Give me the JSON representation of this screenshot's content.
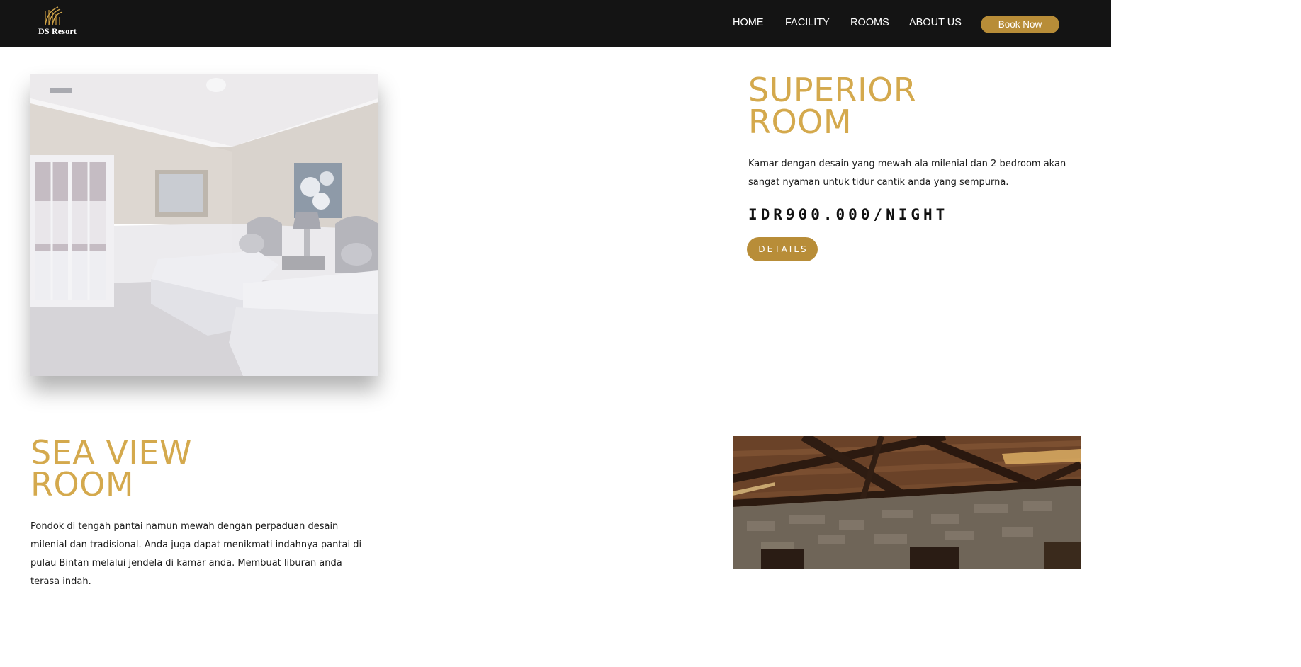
{
  "brand": {
    "logo_text": "DS Resort"
  },
  "nav": {
    "items": [
      {
        "label": "HOME"
      },
      {
        "label": "FACILITY"
      },
      {
        "label": "ROOMS"
      },
      {
        "label": "ABOUT US"
      }
    ],
    "cta_label": "Book Now"
  },
  "colors": {
    "accent": "#b88d38",
    "title_gold": "#d4a94d",
    "navbar_bg": "#141414"
  },
  "rooms": [
    {
      "title_line1": "SUPERIOR",
      "title_line2": "ROOM",
      "description": "Kamar dengan desain yang mewah ala milenial dan 2 bedroom akan sangat nyaman untuk tidur cantik anda yang sempurna.",
      "price": "IDR900.000/NIGHT",
      "details_label": "DETAILS"
    },
    {
      "title_line1": "SEA VIEW",
      "title_line2": "ROOM",
      "description": "Pondok di tengah pantai namun mewah dengan perpaduan desain milenial dan tradisional. Anda juga dapat menikmati indahnya pantai di pulau Bintan melalui jendela di kamar anda. Membuat liburan anda terasa indah."
    }
  ]
}
